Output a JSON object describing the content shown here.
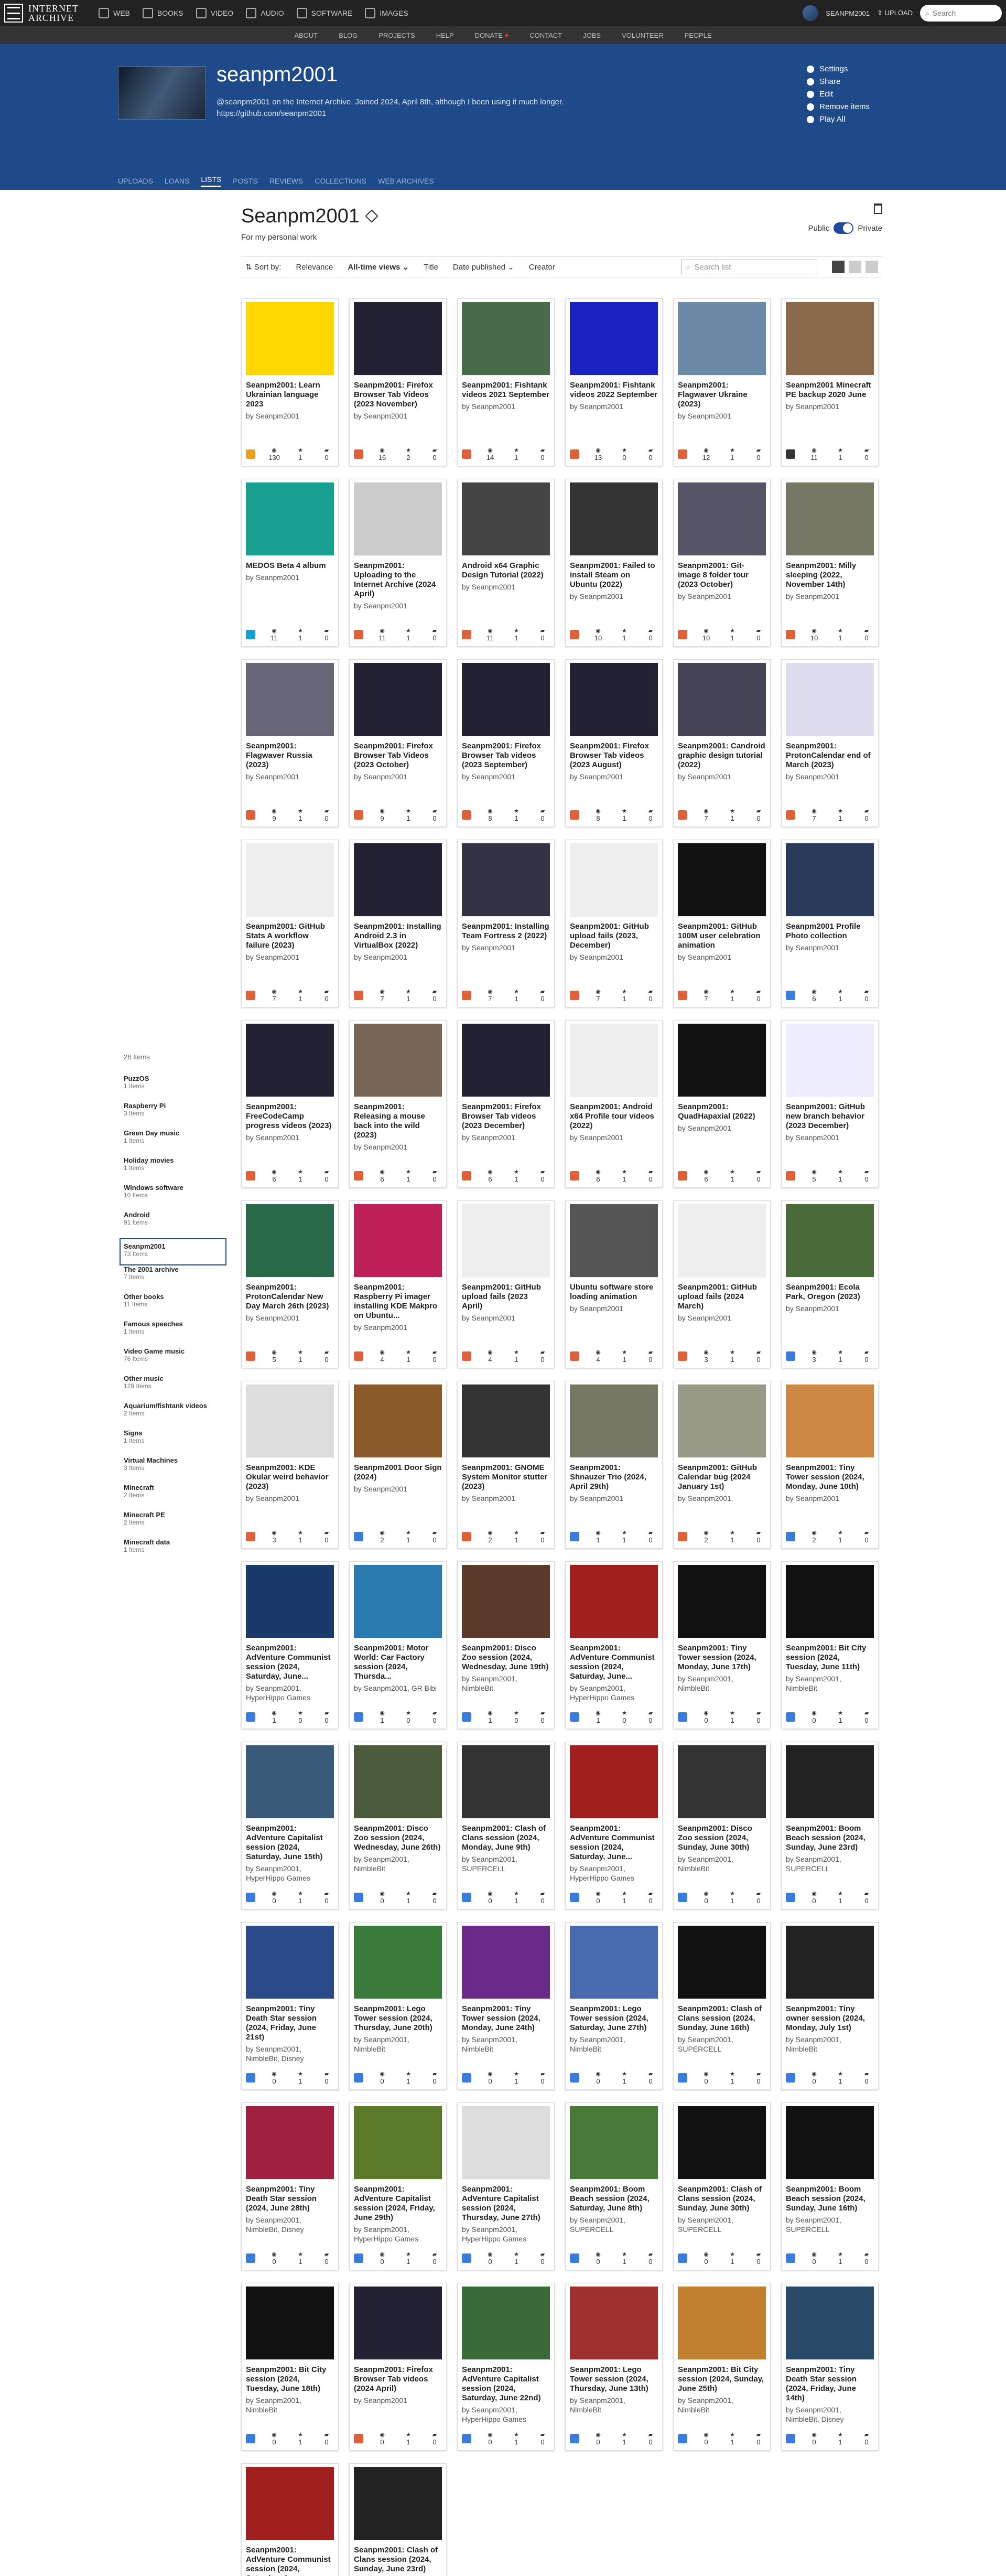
{
  "topnav": {
    "logo_line1": "INTERNET",
    "logo_line2": "ARCHIVE",
    "mediatypes": [
      "WEB",
      "BOOKS",
      "VIDEO",
      "AUDIO",
      "SOFTWARE",
      "IMAGES"
    ],
    "username": "SEANPM2001",
    "upload": "UPLOAD",
    "search_placeholder": "Search"
  },
  "subnav": [
    "ABOUT",
    "BLOG",
    "PROJECTS",
    "HELP",
    "DONATE",
    "CONTACT",
    "JOBS",
    "VOLUNTEER",
    "PEOPLE"
  ],
  "profile": {
    "name": "seanpm2001",
    "desc1": "@seanpm2001 on the Internet Archive. Joined 2024, April 8th, although I been using it much longer.",
    "desc2": "https://github.com/seanpm2001",
    "actions": [
      "Settings",
      "Share",
      "Edit",
      "Remove items",
      "Play All"
    ]
  },
  "tabs": [
    "UPLOADS",
    "LOANS",
    "LISTS",
    "POSTS",
    "REVIEWS",
    "COLLECTIONS",
    "WEB ARCHIVES"
  ],
  "list": {
    "title": "Seanpm2001",
    "desc": "For my personal work",
    "public": "Public",
    "private": "Private"
  },
  "sort": {
    "label": "Sort by:",
    "options": [
      "Relevance",
      "All-time views",
      "Title",
      "Date published",
      "Creator"
    ],
    "search_placeholder": "Search list"
  },
  "sidebar": {
    "count": "28 Items",
    "lists": [
      {
        "name": "PuzzOS",
        "count": "1 Items"
      },
      {
        "name": "Raspberry Pi",
        "count": "3 Items"
      },
      {
        "name": "Green Day music",
        "count": "1 Items"
      },
      {
        "name": "Holiday movies",
        "count": "1 Items"
      },
      {
        "name": "Windows software",
        "count": "10 Items"
      },
      {
        "name": "Android",
        "count": "91 Items"
      },
      {
        "name": "Seanpm2001",
        "count": "73 Items"
      },
      {
        "name": "The 2001 archive",
        "count": "7 Items"
      },
      {
        "name": "Other books",
        "count": "11 Items"
      },
      {
        "name": "Famous speeches",
        "count": "1 Items"
      },
      {
        "name": "Video Game music",
        "count": "76 Items"
      },
      {
        "name": "Other music",
        "count": "128 Items"
      },
      {
        "name": "Aquarium/fishtank videos",
        "count": "2 Items"
      },
      {
        "name": "Signs",
        "count": "1 Items"
      },
      {
        "name": "Virtual Machines",
        "count": "3 Items"
      },
      {
        "name": "Minecraft",
        "count": "2 Items"
      },
      {
        "name": "Minecraft PE",
        "count": "2 Items"
      },
      {
        "name": "Minecraft data",
        "count": "1 Items"
      }
    ]
  },
  "items": [
    {
      "t": "Seanpm2001: Learn Ukrainian language 2023",
      "b": "by Seanpm2001",
      "m": "tx",
      "v": "130",
      "f": "1",
      "r": "0",
      "c": "#ffd700"
    },
    {
      "t": "Seanpm2001: Firefox Browser Tab Videos (2023 November)",
      "b": "by Seanpm2001",
      "m": "mv",
      "v": "16",
      "f": "2",
      "r": "0",
      "c": "#223"
    },
    {
      "t": "Seanpm2001: Fishtank videos 2021 September",
      "b": "by Seanpm2001",
      "m": "mv",
      "v": "14",
      "f": "1",
      "r": "0",
      "c": "#4a6b4a"
    },
    {
      "t": "Seanpm2001: Fishtank videos 2022 September",
      "b": "by Seanpm2001",
      "m": "mv",
      "v": "13",
      "f": "0",
      "r": "0",
      "c": "#1a22c0"
    },
    {
      "t": "Seanpm2001: Flagwaver Ukraine (2023)",
      "b": "by Seanpm2001",
      "m": "mv",
      "v": "12",
      "f": "1",
      "r": "0",
      "c": "#6a8aa8"
    },
    {
      "t": "Seanpm2001 Minecraft PE backup 2020 June",
      "b": "by Seanpm2001",
      "m": "cl",
      "v": "11",
      "f": "1",
      "r": "0",
      "c": "#8a6a4a"
    },
    {
      "t": "MEDOS Beta 4 album",
      "b": "by Seanpm2001",
      "m": "so",
      "v": "11",
      "f": "1",
      "r": "0",
      "c": "#1aa090"
    },
    {
      "t": "Seanpm2001: Uploading to the Internet Archive (2024 April)",
      "b": "by Seanpm2001",
      "m": "mv",
      "v": "11",
      "f": "1",
      "r": "0",
      "c": "#ccc"
    },
    {
      "t": "Android x64 Graphic Design Tutorial (2022)",
      "b": "by Seanpm2001",
      "m": "mv",
      "v": "11",
      "f": "1",
      "r": "0",
      "c": "#444"
    },
    {
      "t": "Seanpm2001: Failed to install Steam on Ubuntu (2022)",
      "b": "by Seanpm2001",
      "m": "mv",
      "v": "10",
      "f": "1",
      "r": "0",
      "c": "#333"
    },
    {
      "t": "Seanpm2001: Git-image 8 folder tour (2023 October)",
      "b": "by Seanpm2001",
      "m": "mv",
      "v": "10",
      "f": "1",
      "r": "0",
      "c": "#556"
    },
    {
      "t": "Seanpm2001: Milly sleeping (2022, November 14th)",
      "b": "by Seanpm2001",
      "m": "mv",
      "v": "10",
      "f": "1",
      "r": "0",
      "c": "#776"
    },
    {
      "t": "Seanpm2001: Flagwaver Russia (2023)",
      "b": "by Seanpm2001",
      "m": "mv",
      "v": "9",
      "f": "1",
      "r": "0",
      "c": "#667"
    },
    {
      "t": "Seanpm2001: Firefox Browser Tab Videos (2023 October)",
      "b": "by Seanpm2001",
      "m": "mv",
      "v": "9",
      "f": "1",
      "r": "0",
      "c": "#223"
    },
    {
      "t": "Seanpm2001: Firefox Browser Tab videos (2023 September)",
      "b": "by Seanpm2001",
      "m": "mv",
      "v": "8",
      "f": "1",
      "r": "0",
      "c": "#223"
    },
    {
      "t": "Seanpm2001: Firefox Browser Tab videos (2023 August)",
      "b": "by Seanpm2001",
      "m": "mv",
      "v": "8",
      "f": "1",
      "r": "0",
      "c": "#223"
    },
    {
      "t": "Seanpm2001: Candroid graphic design tutorial (2022)",
      "b": "by Seanpm2001",
      "m": "mv",
      "v": "7",
      "f": "1",
      "r": "0",
      "c": "#445"
    },
    {
      "t": "Seanpm2001: ProtonCalendar end of March (2023)",
      "b": "by Seanpm2001",
      "m": "mv",
      "v": "7",
      "f": "1",
      "r": "0",
      "c": "#dde"
    },
    {
      "t": "Seanpm2001: GitHub Stats A workflow failure (2023)",
      "b": "by Seanpm2001",
      "m": "mv",
      "v": "7",
      "f": "1",
      "r": "0",
      "c": "#eee"
    },
    {
      "t": "Seanpm2001: Installing Android 2.3 in VirtualBox (2022)",
      "b": "by Seanpm2001",
      "m": "mv",
      "v": "7",
      "f": "1",
      "r": "0",
      "c": "#223"
    },
    {
      "t": "Seanpm2001: Installing Team Fortress 2 (2022)",
      "b": "by Seanpm2001",
      "m": "mv",
      "v": "7",
      "f": "1",
      "r": "0",
      "c": "#334"
    },
    {
      "t": "Seanpm2001: GitHub upload fails (2023, December)",
      "b": "by Seanpm2001",
      "m": "mv",
      "v": "7",
      "f": "1",
      "r": "0",
      "c": "#eee"
    },
    {
      "t": "Seanpm2001: GitHub 100M user celebration animation",
      "b": "by Seanpm2001",
      "m": "mv",
      "v": "7",
      "f": "1",
      "r": "0",
      "c": "#111"
    },
    {
      "t": "Seanpm2001 Profile Photo collection",
      "b": "by Seanpm2001",
      "m": "im",
      "v": "6",
      "f": "1",
      "r": "0",
      "c": "#2a3a5a"
    },
    {
      "t": "Seanpm2001: FreeCodeCamp progress videos (2023)",
      "b": "by Seanpm2001",
      "m": "mv",
      "v": "6",
      "f": "1",
      "r": "0",
      "c": "#223"
    },
    {
      "t": "Seanpm2001: Releasing a mouse back into the wild (2023)",
      "b": "by Seanpm2001",
      "m": "mv",
      "v": "6",
      "f": "1",
      "r": "0",
      "c": "#776655"
    },
    {
      "t": "Seanpm2001: Firefox Browser Tab videos (2023 December)",
      "b": "by Seanpm2001",
      "m": "mv",
      "v": "6",
      "f": "1",
      "r": "0",
      "c": "#223"
    },
    {
      "t": "Seanpm2001: Android x64 Profile tour videos (2022)",
      "b": "by Seanpm2001",
      "m": "mv",
      "v": "6",
      "f": "1",
      "r": "0",
      "c": "#eee"
    },
    {
      "t": "Seanpm2001: QuadHapaxial (2022)",
      "b": "by Seanpm2001",
      "m": "mv",
      "v": "6",
      "f": "1",
      "r": "0",
      "c": "#111"
    },
    {
      "t": "Seanpm2001: GitHub new branch behavior (2023 December)",
      "b": "by Seanpm2001",
      "m": "mv",
      "v": "5",
      "f": "1",
      "r": "0",
      "c": "#eef"
    },
    {
      "t": "Seanpm2001: ProtonCalendar New Day March 26th (2023)",
      "b": "by Seanpm2001",
      "m": "mv",
      "v": "5",
      "f": "1",
      "r": "0",
      "c": "#2a6a4a"
    },
    {
      "t": "Seanpm2001: Raspberry Pi imager installing KDE Makpro on Ubuntu...",
      "b": "by Seanpm2001",
      "m": "mv",
      "v": "4",
      "f": "1",
      "r": "0",
      "c": "#c0205a"
    },
    {
      "t": "Seanpm2001: GitHub upload fails (2023 April)",
      "b": "by Seanpm2001",
      "m": "mv",
      "v": "4",
      "f": "1",
      "r": "0",
      "c": "#eee"
    },
    {
      "t": "Ubuntu software store loading animation",
      "b": "by Seanpm2001",
      "m": "mv",
      "v": "4",
      "f": "1",
      "r": "0",
      "c": "#555"
    },
    {
      "t": "Seanpm2001: GitHub upload fails (2024 March)",
      "b": "by Seanpm2001",
      "m": "mv",
      "v": "3",
      "f": "1",
      "r": "0",
      "c": "#eee"
    },
    {
      "t": "Seanpm2001: Ecola Park, Oregon (2023)",
      "b": "by Seanpm2001",
      "m": "im",
      "v": "3",
      "f": "1",
      "r": "0",
      "c": "#4a6a3a"
    },
    {
      "t": "Seanpm2001: KDE Okular weird behavior (2023)",
      "b": "by Seanpm2001",
      "m": "mv",
      "v": "3",
      "f": "1",
      "r": "0",
      "c": "#ddd"
    },
    {
      "t": "Seanpm2001 Door Sign (2024)",
      "b": "by Seanpm2001",
      "m": "im",
      "v": "2",
      "f": "1",
      "r": "0",
      "c": "#8a5a2a"
    },
    {
      "t": "Seanpm2001: GNOME System Monitor stutter (2023)",
      "b": "by Seanpm2001",
      "m": "mv",
      "v": "2",
      "f": "1",
      "r": "0",
      "c": "#333"
    },
    {
      "t": "Seanpm2001: Shnauzer Trio (2024, April 29th)",
      "b": "by Seanpm2001",
      "m": "im",
      "v": "1",
      "f": "1",
      "r": "0",
      "c": "#776"
    },
    {
      "t": "Seanpm2001: GitHub Calendar bug (2024 January 1st)",
      "b": "by Seanpm2001",
      "m": "mv",
      "v": "2",
      "f": "1",
      "r": "0",
      "c": "#998"
    },
    {
      "t": "Seanpm2001: Tiny Tower session (2024, Monday, June 10th)",
      "b": "by Seanpm2001",
      "m": "im",
      "v": "2",
      "f": "1",
      "r": "0",
      "c": "#c84"
    },
    {
      "t": "Seanpm2001: AdVenture Communist session (2024, Saturday, June...",
      "b": "by Seanpm2001, HyperHippo Games",
      "m": "im",
      "v": "1",
      "f": "0",
      "r": "0",
      "c": "#1a3a6a"
    },
    {
      "t": "Seanpm2001: Motor World: Car Factory session (2024, Thursda...",
      "b": "by Seanpm2001, GR Bibi",
      "m": "im",
      "v": "1",
      "f": "0",
      "r": "0",
      "c": "#2a7ab0"
    },
    {
      "t": "Seanpm2001: Disco Zoo session (2024, Wednesday, June 19th)",
      "b": "by Seanpm2001, NimbleBit",
      "m": "im",
      "v": "1",
      "f": "0",
      "r": "0",
      "c": "#5a3a2a"
    },
    {
      "t": "Seanpm2001: AdVenture Communist session (2024, Saturday, June...",
      "b": "by Seanpm2001, HyperHippo Games",
      "m": "im",
      "v": "1",
      "f": "0",
      "r": "0",
      "c": "#a02020"
    },
    {
      "t": "Seanpm2001: Tiny Tower session (2024, Monday, June 17th)",
      "b": "by Seanpm2001, NimbleBit",
      "m": "im",
      "v": "0",
      "f": "1",
      "r": "0",
      "c": "#111"
    },
    {
      "t": "Seanpm2001: Bit City session (2024, Tuesday, June 11th)",
      "b": "by Seanpm2001, NimbleBit",
      "m": "im",
      "v": "0",
      "f": "1",
      "r": "0",
      "c": "#111"
    },
    {
      "t": "Seanpm2001: AdVenture Capitalist session (2024, Saturday, June 15th)",
      "b": "by Seanpm2001, HyperHippo Games",
      "m": "im",
      "v": "0",
      "f": "1",
      "r": "0",
      "c": "#3a5a7a"
    },
    {
      "t": "Seanpm2001: Disco Zoo session (2024, Wednesday, June 26th)",
      "b": "by Seanpm2001, NimbleBit",
      "m": "im",
      "v": "0",
      "f": "1",
      "r": "0",
      "c": "#4a5a3a"
    },
    {
      "t": "Seanpm2001: Clash of Clans session (2024, Monday, June 9th)",
      "b": "by Seanpm2001, SUPERCELL",
      "m": "im",
      "v": "0",
      "f": "1",
      "r": "0",
      "c": "#333"
    },
    {
      "t": "Seanpm2001: AdVenture Communist session (2024, Saturday, June...",
      "b": "by Seanpm2001, HyperHippo Games",
      "m": "im",
      "v": "0",
      "f": "1",
      "r": "0",
      "c": "#a02020"
    },
    {
      "t": "Seanpm2001: Disco Zoo session (2024, Sunday, June 30th)",
      "b": "by Seanpm2001, NimbleBit",
      "m": "im",
      "v": "0",
      "f": "1",
      "r": "0",
      "c": "#333"
    },
    {
      "t": "Seanpm2001: Boom Beach session (2024, Sunday, June 23rd)",
      "b": "by Seanpm2001, SUPERCELL",
      "m": "im",
      "v": "0",
      "f": "1",
      "r": "0",
      "c": "#222"
    },
    {
      "t": "Seanpm2001: Tiny Death Star session (2024, Friday, June 21st)",
      "b": "by Seanpm2001, NimbleBit, Disney",
      "m": "im",
      "v": "0",
      "f": "1",
      "r": "0",
      "c": "#2a4a8a"
    },
    {
      "t": "Seanpm2001: Lego Tower session (2024, Thursday, June 20th)",
      "b": "by Seanpm2001, NimbleBit",
      "m": "im",
      "v": "0",
      "f": "1",
      "r": "0",
      "c": "#3a7a3a"
    },
    {
      "t": "Seanpm2001: Tiny Tower session (2024, Monday, June 24th)",
      "b": "by Seanpm2001, NimbleBit",
      "m": "im",
      "v": "0",
      "f": "1",
      "r": "0",
      "c": "#6a2a8a"
    },
    {
      "t": "Seanpm2001: Lego Tower session (2024, Saturday, June 27th)",
      "b": "by Seanpm2001, NimbleBit",
      "m": "im",
      "v": "0",
      "f": "1",
      "r": "0",
      "c": "#4a6ab0"
    },
    {
      "t": "Seanpm2001: Clash of Clans session (2024, Sunday, June 16th)",
      "b": "by Seanpm2001, SUPERCELL",
      "m": "im",
      "v": "0",
      "f": "1",
      "r": "0",
      "c": "#111"
    },
    {
      "t": "Seanpm2001: Tiny owner session (2024, Monday, July 1st)",
      "b": "by Seanpm2001, NimbleBit",
      "m": "im",
      "v": "0",
      "f": "1",
      "r": "0",
      "c": "#222"
    },
    {
      "t": "Seanpm2001: Tiny Death Star session (2024, June 28th)",
      "b": "by Seanpm2001, NimbleBit, Disney",
      "m": "im",
      "v": "0",
      "f": "1",
      "r": "0",
      "c": "#a02040"
    },
    {
      "t": "Seanpm2001: AdVenture Capitalist session (2024, Friday, June 29th)",
      "b": "by Seanpm2001, HyperHippo Games",
      "m": "im",
      "v": "0",
      "f": "1",
      "r": "0",
      "c": "#5a7a2a"
    },
    {
      "t": "Seanpm2001: AdVenture Capitalist session (2024, Thursday, June 27th)",
      "b": "by Seanpm2001, HyperHippo Games",
      "m": "im",
      "v": "0",
      "f": "1",
      "r": "0",
      "c": "#ddd"
    },
    {
      "t": "Seanpm2001: Boom Beach session (2024, Saturday, June 8th)",
      "b": "by Seanpm2001, SUPERCELL",
      "m": "im",
      "v": "0",
      "f": "1",
      "r": "0",
      "c": "#4a7a3a"
    },
    {
      "t": "Seanpm2001: Clash of Clans session (2024, Sunday, June 30th)",
      "b": "by Seanpm2001, SUPERCELL",
      "m": "im",
      "v": "0",
      "f": "1",
      "r": "0",
      "c": "#111"
    },
    {
      "t": "Seanpm2001: Boom Beach session (2024, Sunday, June 16th)",
      "b": "by Seanpm2001, SUPERCELL",
      "m": "im",
      "v": "0",
      "f": "1",
      "r": "0",
      "c": "#111"
    },
    {
      "t": "Seanpm2001: Bit City session (2024, Tuesday, June 18th)",
      "b": "by Seanpm2001, NimbleBit",
      "m": "im",
      "v": "0",
      "f": "1",
      "r": "0",
      "c": "#111"
    },
    {
      "t": "Seanpm2001: Firefox Browser Tab videos (2024 April)",
      "b": "by Seanpm2001",
      "m": "mv",
      "v": "0",
      "f": "1",
      "r": "0",
      "c": "#223"
    },
    {
      "t": "Seanpm2001: AdVenture Capitalist session (2024, Saturday, June 22nd)",
      "b": "by Seanpm2001, HyperHippo Games",
      "m": "im",
      "v": "0",
      "f": "1",
      "r": "0",
      "c": "#3a6a3a"
    },
    {
      "t": "Seanpm2001: Lego Tower session (2024, Thursday, June 13th)",
      "b": "by Seanpm2001, NimbleBit",
      "m": "im",
      "v": "0",
      "f": "1",
      "r": "0",
      "c": "#a03030"
    },
    {
      "t": "Seanpm2001: Bit City session (2024, Sunday, June 25th)",
      "b": "by Seanpm2001, NimbleBit",
      "m": "im",
      "v": "0",
      "f": "1",
      "r": "0",
      "c": "#c08030"
    },
    {
      "t": "Seanpm2001: Tiny Death Star session (2024, Friday, June 14th)",
      "b": "by Seanpm2001, NimbleBit, Disney",
      "m": "im",
      "v": "0",
      "f": "1",
      "r": "0",
      "c": "#2a4a6a"
    },
    {
      "t": "Seanpm2001: AdVenture Communist session (2024, Saturday, June...",
      "b": "by Seanpm2001, HyperHippo Games",
      "m": "im",
      "v": "0",
      "f": "1",
      "r": "0",
      "c": "#a02020"
    },
    {
      "t": "Seanpm2001: Clash of Clans session (2024, Sunday, June 23rd)",
      "b": "by Seanpm2001, SUPERCELL",
      "m": "im",
      "v": "0",
      "f": "1",
      "r": "0",
      "c": "#222"
    }
  ]
}
